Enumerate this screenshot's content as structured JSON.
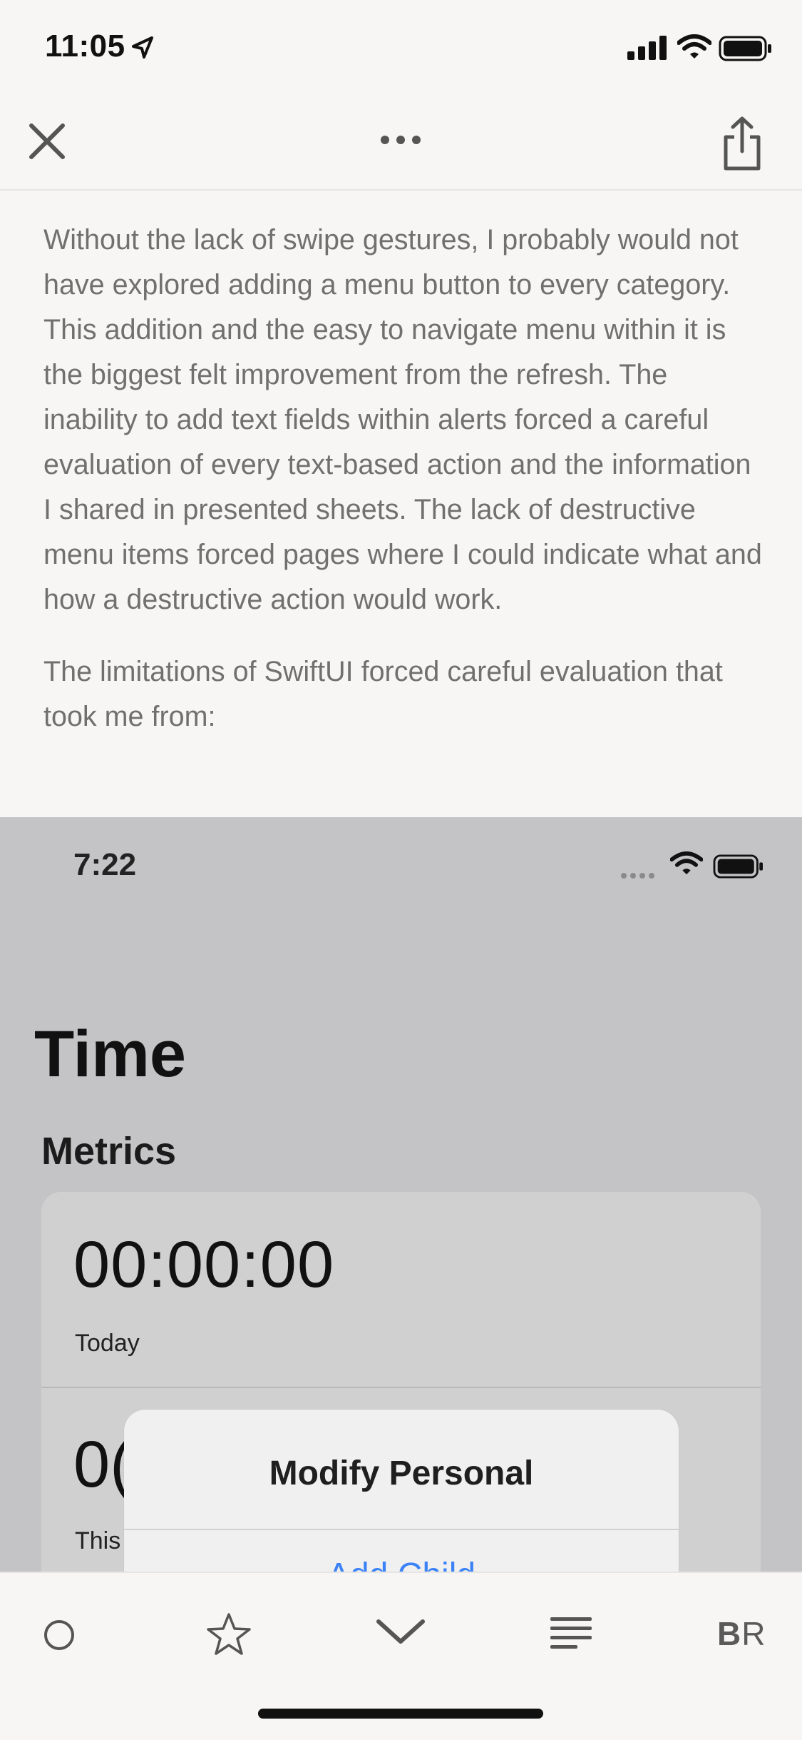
{
  "status_bar": {
    "time": "11:05"
  },
  "nav": {
    "close_icon": "close-icon",
    "more_icon": "more-icon",
    "share_icon": "share-icon"
  },
  "article": {
    "paragraph1": "Without the lack of swipe gestures, I probably would not have explored adding a menu button to every category. This addition and the easy to navigate menu within it is the biggest felt improvement from the refresh. The inability to add text fields within alerts forced a careful evaluation of every text-based action and the information I shared in presented sheets. The lack of destructive menu items forced pages where I could indicate what and how a destructive action would work.",
    "paragraph2": "The limitations of SwiftUI forced careful evaluation that took me from:"
  },
  "embed": {
    "time": "7:22",
    "title": "Time",
    "section": "Metrics",
    "card": {
      "value1": "00:00:00",
      "label1": "Today",
      "value2": "0(",
      "label2": "This"
    },
    "alert": {
      "title": "Modify Personal",
      "action": "Add Child"
    }
  },
  "toolbar": {
    "br_b": "B",
    "br_r": "R",
    "icons": [
      "circle-icon",
      "star-icon",
      "chevron-down-icon",
      "text-lines-icon"
    ]
  }
}
